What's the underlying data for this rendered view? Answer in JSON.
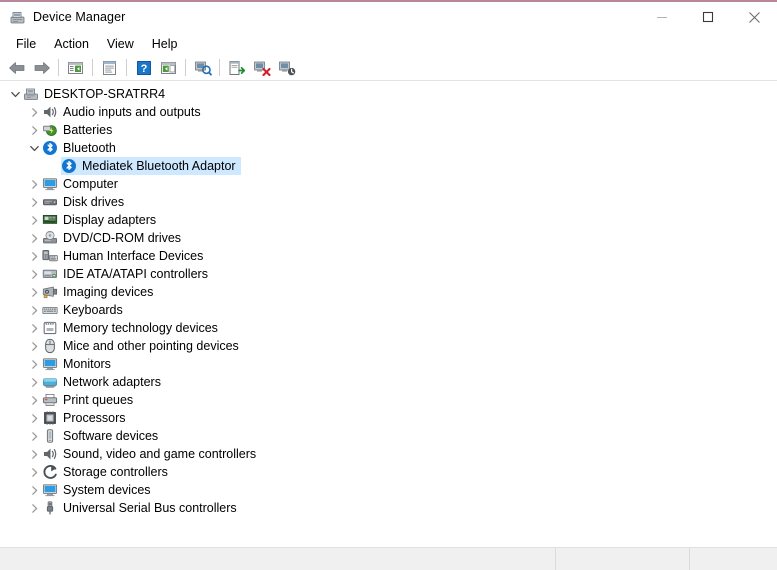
{
  "window": {
    "title": "Device Manager",
    "title_icon": "device-manager-icon",
    "accent_color": "#b9879c",
    "minimize_label": "Minimize",
    "maximize_label": "Maximize",
    "close_label": "Close"
  },
  "menubar": {
    "items": [
      {
        "label": "File",
        "name": "menu-file"
      },
      {
        "label": "Action",
        "name": "menu-action"
      },
      {
        "label": "View",
        "name": "menu-view"
      },
      {
        "label": "Help",
        "name": "menu-help"
      }
    ]
  },
  "toolbar": {
    "buttons": [
      {
        "icon": "back-arrow-icon",
        "tooltip": "Back"
      },
      {
        "icon": "forward-arrow-icon",
        "tooltip": "Forward"
      },
      {
        "icon": "show-hide-console-tree-icon",
        "tooltip": "Show/Hide Console Tree"
      },
      {
        "icon": "properties-icon",
        "tooltip": "Properties"
      },
      {
        "icon": "help-icon",
        "tooltip": "Help"
      },
      {
        "icon": "show-hide-action-pane-icon",
        "tooltip": "Show/Hide Action Pane"
      },
      {
        "icon": "scan-for-hardware-changes-icon",
        "tooltip": "Scan for hardware changes"
      },
      {
        "icon": "update-driver-icon",
        "tooltip": "Update driver"
      },
      {
        "icon": "disable-device-icon",
        "tooltip": "Disable device"
      },
      {
        "icon": "uninstall-device-icon",
        "tooltip": "Uninstall device"
      }
    ]
  },
  "tree": {
    "selection_color": "#cde8ff",
    "nodes": [
      {
        "label": "DESKTOP-SRATRR4",
        "depth": 0,
        "state": "expanded",
        "icon": "computer-root-icon",
        "selected": false
      },
      {
        "label": "Audio inputs and outputs",
        "depth": 1,
        "state": "collapsed",
        "icon": "speaker-icon",
        "selected": false
      },
      {
        "label": "Batteries",
        "depth": 1,
        "state": "collapsed",
        "icon": "battery-icon",
        "selected": false
      },
      {
        "label": "Bluetooth",
        "depth": 1,
        "state": "expanded",
        "icon": "bluetooth-icon",
        "selected": false
      },
      {
        "label": "Mediatek Bluetooth Adaptor",
        "depth": 2,
        "state": "leaf",
        "icon": "bluetooth-icon",
        "selected": true
      },
      {
        "label": "Computer",
        "depth": 1,
        "state": "collapsed",
        "icon": "monitor-icon",
        "selected": false
      },
      {
        "label": "Disk drives",
        "depth": 1,
        "state": "collapsed",
        "icon": "disk-drive-icon",
        "selected": false
      },
      {
        "label": "Display adapters",
        "depth": 1,
        "state": "collapsed",
        "icon": "display-adapter-icon",
        "selected": false
      },
      {
        "label": "DVD/CD-ROM drives",
        "depth": 1,
        "state": "collapsed",
        "icon": "dvd-drive-icon",
        "selected": false
      },
      {
        "label": "Human Interface Devices",
        "depth": 1,
        "state": "collapsed",
        "icon": "hid-icon",
        "selected": false
      },
      {
        "label": "IDE ATA/ATAPI controllers",
        "depth": 1,
        "state": "collapsed",
        "icon": "ide-controller-icon",
        "selected": false
      },
      {
        "label": "Imaging devices",
        "depth": 1,
        "state": "collapsed",
        "icon": "camera-icon",
        "selected": false
      },
      {
        "label": "Keyboards",
        "depth": 1,
        "state": "collapsed",
        "icon": "keyboard-icon",
        "selected": false
      },
      {
        "label": "Memory technology devices",
        "depth": 1,
        "state": "collapsed",
        "icon": "memory-card-icon",
        "selected": false
      },
      {
        "label": "Mice and other pointing devices",
        "depth": 1,
        "state": "collapsed",
        "icon": "mouse-icon",
        "selected": false
      },
      {
        "label": "Monitors",
        "depth": 1,
        "state": "collapsed",
        "icon": "monitor-icon",
        "selected": false
      },
      {
        "label": "Network adapters",
        "depth": 1,
        "state": "collapsed",
        "icon": "network-adapter-icon",
        "selected": false
      },
      {
        "label": "Print queues",
        "depth": 1,
        "state": "collapsed",
        "icon": "printer-icon",
        "selected": false
      },
      {
        "label": "Processors",
        "depth": 1,
        "state": "collapsed",
        "icon": "processor-icon",
        "selected": false
      },
      {
        "label": "Software devices",
        "depth": 1,
        "state": "collapsed",
        "icon": "software-device-icon",
        "selected": false
      },
      {
        "label": "Sound, video and game controllers",
        "depth": 1,
        "state": "collapsed",
        "icon": "speaker-icon",
        "selected": false
      },
      {
        "label": "Storage controllers",
        "depth": 1,
        "state": "collapsed",
        "icon": "storage-controller-icon",
        "selected": false
      },
      {
        "label": "System devices",
        "depth": 1,
        "state": "collapsed",
        "icon": "monitor-icon",
        "selected": false
      },
      {
        "label": "Universal Serial Bus controllers",
        "depth": 1,
        "state": "collapsed",
        "icon": "usb-icon",
        "selected": false
      }
    ]
  },
  "statusbar": {
    "cells": [
      "",
      "",
      ""
    ]
  }
}
